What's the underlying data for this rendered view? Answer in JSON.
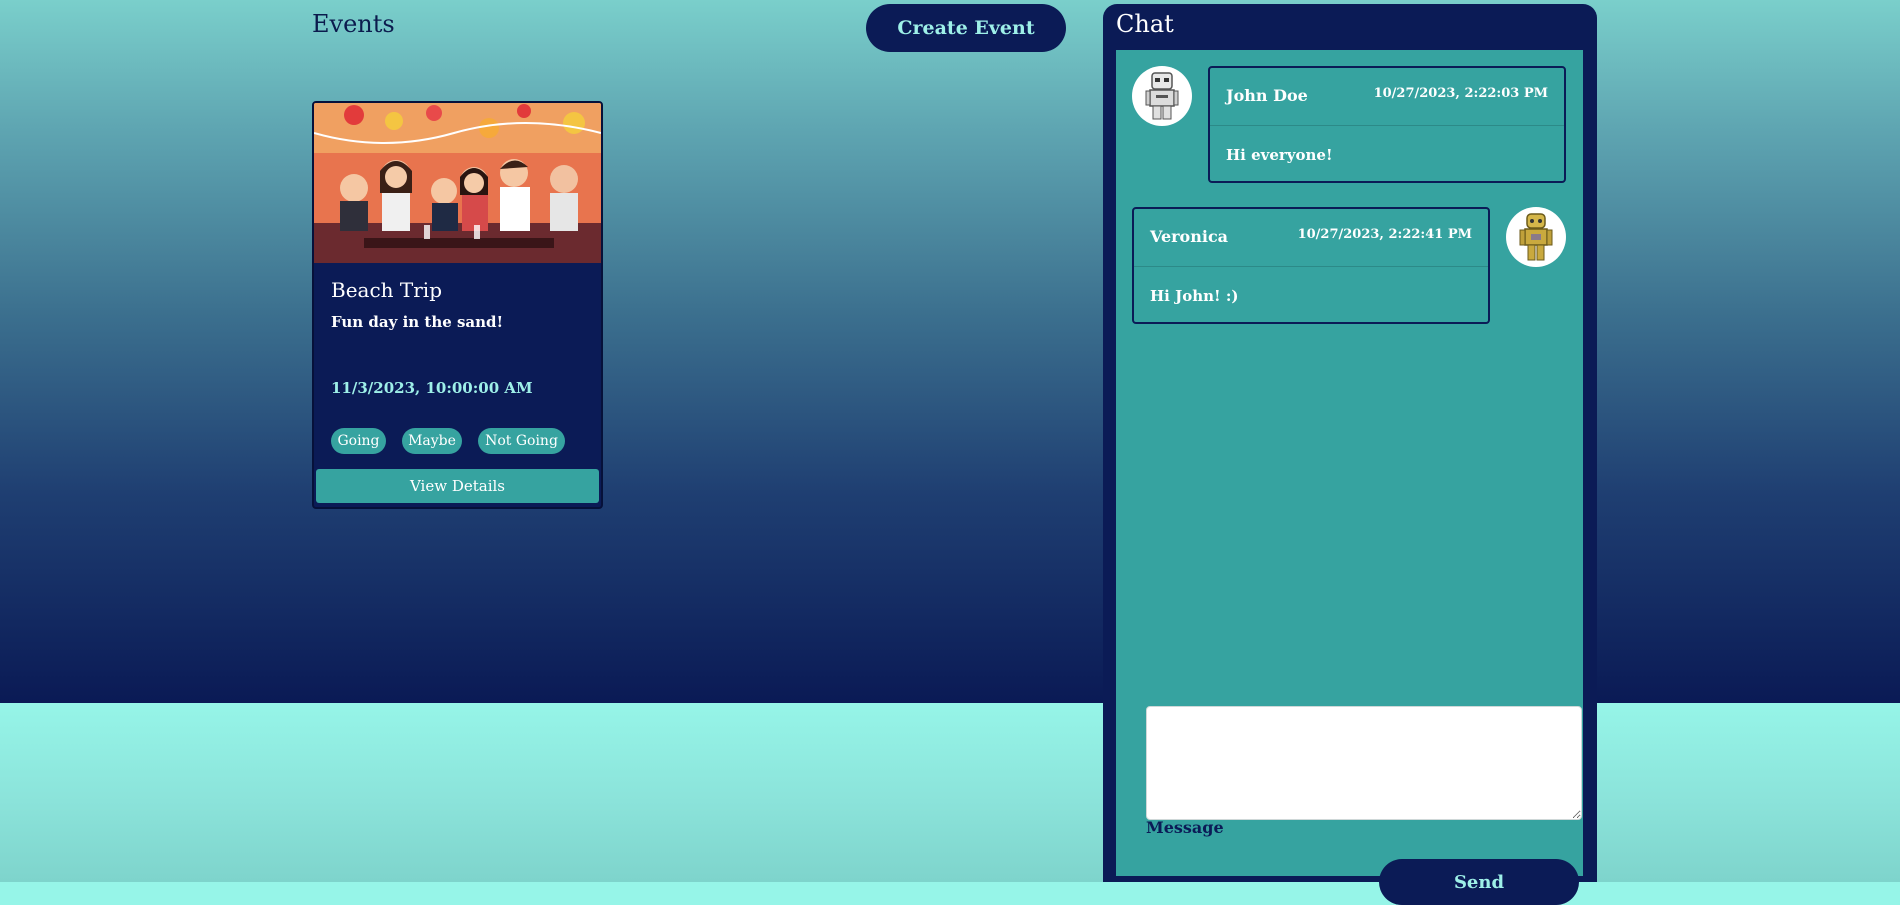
{
  "events": {
    "title": "Events",
    "create_button": "Create Event",
    "cards": [
      {
        "title": "Beach Trip",
        "description": "Fun day in the sand!",
        "date": "11/3/2023, 10:00:00 AM",
        "rsvp": [
          "Going",
          "Maybe",
          "Not Going"
        ],
        "view_button": "View Details",
        "image": "party-illustration"
      }
    ]
  },
  "chat": {
    "title": "Chat",
    "messages": [
      {
        "name": "John Doe",
        "time": "10/27/2023, 2:22:03 PM",
        "text": "Hi everyone!",
        "avatar": "stormtrooper-avatar"
      },
      {
        "name": "Veronica",
        "time": "10/27/2023, 2:22:41 PM",
        "text": "Hi John! :)",
        "avatar": "droid-avatar"
      }
    ],
    "input_label": "Message",
    "input_value": "",
    "send_button": "Send"
  },
  "colors": {
    "navy": "#0b1b56",
    "teal": "#36a3a0",
    "mint": "#96f5e8",
    "accent_text": "#9ef0e8"
  }
}
